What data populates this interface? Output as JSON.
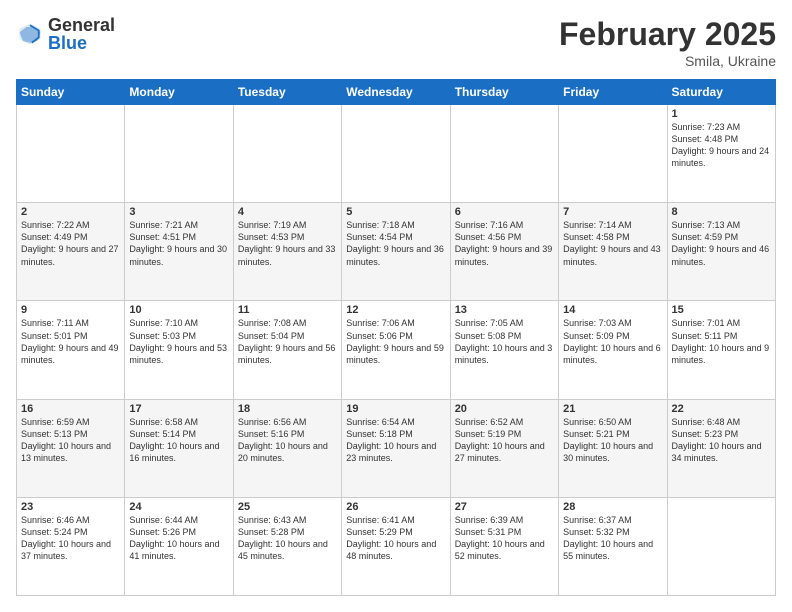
{
  "logo": {
    "general": "General",
    "blue": "Blue"
  },
  "title": "February 2025",
  "location": "Smila, Ukraine",
  "days_of_week": [
    "Sunday",
    "Monday",
    "Tuesday",
    "Wednesday",
    "Thursday",
    "Friday",
    "Saturday"
  ],
  "weeks": [
    [
      {
        "day": "",
        "info": ""
      },
      {
        "day": "",
        "info": ""
      },
      {
        "day": "",
        "info": ""
      },
      {
        "day": "",
        "info": ""
      },
      {
        "day": "",
        "info": ""
      },
      {
        "day": "",
        "info": ""
      },
      {
        "day": "1",
        "info": "Sunrise: 7:23 AM\nSunset: 4:48 PM\nDaylight: 9 hours and 24 minutes."
      }
    ],
    [
      {
        "day": "2",
        "info": "Sunrise: 7:22 AM\nSunset: 4:49 PM\nDaylight: 9 hours and 27 minutes."
      },
      {
        "day": "3",
        "info": "Sunrise: 7:21 AM\nSunset: 4:51 PM\nDaylight: 9 hours and 30 minutes."
      },
      {
        "day": "4",
        "info": "Sunrise: 7:19 AM\nSunset: 4:53 PM\nDaylight: 9 hours and 33 minutes."
      },
      {
        "day": "5",
        "info": "Sunrise: 7:18 AM\nSunset: 4:54 PM\nDaylight: 9 hours and 36 minutes."
      },
      {
        "day": "6",
        "info": "Sunrise: 7:16 AM\nSunset: 4:56 PM\nDaylight: 9 hours and 39 minutes."
      },
      {
        "day": "7",
        "info": "Sunrise: 7:14 AM\nSunset: 4:58 PM\nDaylight: 9 hours and 43 minutes."
      },
      {
        "day": "8",
        "info": "Sunrise: 7:13 AM\nSunset: 4:59 PM\nDaylight: 9 hours and 46 minutes."
      }
    ],
    [
      {
        "day": "9",
        "info": "Sunrise: 7:11 AM\nSunset: 5:01 PM\nDaylight: 9 hours and 49 minutes."
      },
      {
        "day": "10",
        "info": "Sunrise: 7:10 AM\nSunset: 5:03 PM\nDaylight: 9 hours and 53 minutes."
      },
      {
        "day": "11",
        "info": "Sunrise: 7:08 AM\nSunset: 5:04 PM\nDaylight: 9 hours and 56 minutes."
      },
      {
        "day": "12",
        "info": "Sunrise: 7:06 AM\nSunset: 5:06 PM\nDaylight: 9 hours and 59 minutes."
      },
      {
        "day": "13",
        "info": "Sunrise: 7:05 AM\nSunset: 5:08 PM\nDaylight: 10 hours and 3 minutes."
      },
      {
        "day": "14",
        "info": "Sunrise: 7:03 AM\nSunset: 5:09 PM\nDaylight: 10 hours and 6 minutes."
      },
      {
        "day": "15",
        "info": "Sunrise: 7:01 AM\nSunset: 5:11 PM\nDaylight: 10 hours and 9 minutes."
      }
    ],
    [
      {
        "day": "16",
        "info": "Sunrise: 6:59 AM\nSunset: 5:13 PM\nDaylight: 10 hours and 13 minutes."
      },
      {
        "day": "17",
        "info": "Sunrise: 6:58 AM\nSunset: 5:14 PM\nDaylight: 10 hours and 16 minutes."
      },
      {
        "day": "18",
        "info": "Sunrise: 6:56 AM\nSunset: 5:16 PM\nDaylight: 10 hours and 20 minutes."
      },
      {
        "day": "19",
        "info": "Sunrise: 6:54 AM\nSunset: 5:18 PM\nDaylight: 10 hours and 23 minutes."
      },
      {
        "day": "20",
        "info": "Sunrise: 6:52 AM\nSunset: 5:19 PM\nDaylight: 10 hours and 27 minutes."
      },
      {
        "day": "21",
        "info": "Sunrise: 6:50 AM\nSunset: 5:21 PM\nDaylight: 10 hours and 30 minutes."
      },
      {
        "day": "22",
        "info": "Sunrise: 6:48 AM\nSunset: 5:23 PM\nDaylight: 10 hours and 34 minutes."
      }
    ],
    [
      {
        "day": "23",
        "info": "Sunrise: 6:46 AM\nSunset: 5:24 PM\nDaylight: 10 hours and 37 minutes."
      },
      {
        "day": "24",
        "info": "Sunrise: 6:44 AM\nSunset: 5:26 PM\nDaylight: 10 hours and 41 minutes."
      },
      {
        "day": "25",
        "info": "Sunrise: 6:43 AM\nSunset: 5:28 PM\nDaylight: 10 hours and 45 minutes."
      },
      {
        "day": "26",
        "info": "Sunrise: 6:41 AM\nSunset: 5:29 PM\nDaylight: 10 hours and 48 minutes."
      },
      {
        "day": "27",
        "info": "Sunrise: 6:39 AM\nSunset: 5:31 PM\nDaylight: 10 hours and 52 minutes."
      },
      {
        "day": "28",
        "info": "Sunrise: 6:37 AM\nSunset: 5:32 PM\nDaylight: 10 hours and 55 minutes."
      },
      {
        "day": "",
        "info": ""
      }
    ]
  ]
}
